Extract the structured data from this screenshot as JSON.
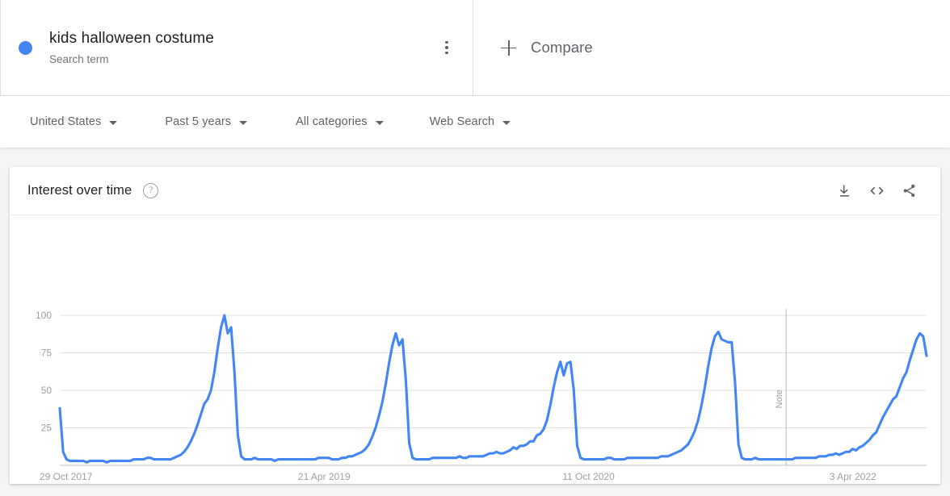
{
  "search_term": {
    "title": "kids halloween costume",
    "subtitle": "Search term",
    "dot_color": "#4285f4",
    "menu_icon": "more-vert-icon"
  },
  "compare": {
    "label": "Compare",
    "icon": "plus-icon"
  },
  "filters": [
    {
      "label": "United States"
    },
    {
      "label": "Past 5 years"
    },
    {
      "label": "All categories"
    },
    {
      "label": "Web Search"
    }
  ],
  "card": {
    "title": "Interest over time",
    "help_icon": "question-mark-icon",
    "tools": [
      {
        "name": "download-icon"
      },
      {
        "name": "embed-code-icon"
      },
      {
        "name": "share-icon"
      }
    ]
  },
  "chart_data": {
    "type": "line",
    "title": "Interest over time",
    "xlabel": "",
    "ylabel": "",
    "ylim": [
      0,
      100
    ],
    "yticks": [
      100,
      75,
      50,
      25
    ],
    "grid": true,
    "legend": false,
    "line_color": "#4285f4",
    "xtick_labels": [
      "29 Oct 2017",
      "21 Apr 2019",
      "11 Oct 2020",
      "3 Apr 2022"
    ],
    "xtick_positions": [
      0,
      0.305,
      0.61,
      0.915
    ],
    "annotations": [
      {
        "label": "Note",
        "x_fraction": 0.838
      }
    ],
    "series": [
      {
        "name": "kids halloween costume",
        "values": [
          38,
          9,
          4,
          3,
          3,
          3,
          3,
          3,
          2,
          3,
          3,
          3,
          3,
          3,
          2,
          3,
          3,
          3,
          3,
          3,
          3,
          3,
          4,
          4,
          4,
          4,
          5,
          5,
          4,
          4,
          4,
          4,
          4,
          4,
          5,
          6,
          7,
          9,
          12,
          16,
          21,
          27,
          34,
          41,
          44,
          50,
          62,
          78,
          92,
          100,
          88,
          92,
          62,
          20,
          6,
          4,
          4,
          4,
          5,
          4,
          4,
          4,
          4,
          4,
          3,
          4,
          4,
          4,
          4,
          4,
          4,
          4,
          4,
          4,
          4,
          4,
          4,
          5,
          5,
          5,
          5,
          4,
          4,
          4,
          5,
          5,
          6,
          6,
          7,
          8,
          9,
          11,
          14,
          19,
          25,
          33,
          42,
          54,
          68,
          80,
          88,
          80,
          84,
          57,
          15,
          5,
          4,
          4,
          4,
          4,
          4,
          5,
          5,
          5,
          5,
          5,
          5,
          5,
          5,
          6,
          5,
          5,
          6,
          6,
          6,
          6,
          6,
          7,
          8,
          8,
          9,
          8,
          8,
          9,
          10,
          12,
          11,
          13,
          13,
          14,
          16,
          16,
          20,
          21,
          24,
          30,
          40,
          52,
          62,
          69,
          60,
          68,
          69,
          50,
          13,
          5,
          4,
          4,
          4,
          4,
          4,
          4,
          4,
          5,
          5,
          4,
          4,
          4,
          4,
          5,
          5,
          5,
          5,
          5,
          5,
          5,
          5,
          5,
          5,
          6,
          6,
          6,
          7,
          8,
          9,
          10,
          12,
          14,
          18,
          23,
          30,
          40,
          52,
          66,
          78,
          86,
          89,
          84,
          83,
          82,
          82,
          55,
          14,
          5,
          4,
          4,
          4,
          5,
          4,
          4,
          4,
          4,
          4,
          4,
          4,
          4,
          4,
          4,
          4,
          5,
          5,
          5,
          5,
          5,
          5,
          5,
          6,
          6,
          6,
          7,
          7,
          8,
          7,
          8,
          9,
          9,
          11,
          10,
          12,
          13,
          15,
          17,
          20,
          22,
          27,
          32,
          36,
          40,
          44,
          46,
          52,
          58,
          62,
          70,
          77,
          84,
          88,
          86,
          73
        ]
      }
    ]
  }
}
